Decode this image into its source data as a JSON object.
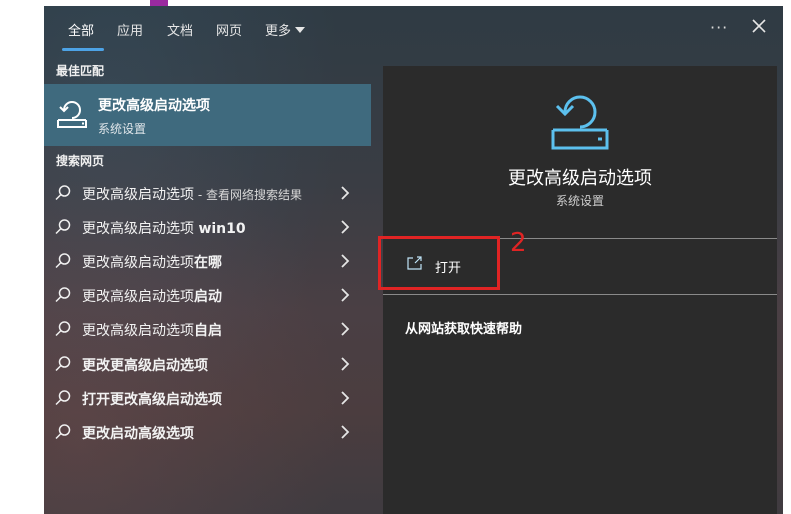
{
  "tabs": [
    {
      "label": "全部"
    },
    {
      "label": "应用"
    },
    {
      "label": "文档"
    },
    {
      "label": "网页"
    },
    {
      "label": "更多"
    }
  ],
  "header": {
    "more_dots": "···"
  },
  "best_match": {
    "heading": "最佳匹配",
    "title": "更改高级启动选项",
    "subtitle": "系统设置",
    "icon": "restore-icon"
  },
  "web": {
    "heading": "搜索网页",
    "results": [
      {
        "plain": "更改高级启动选项",
        "bold": "",
        "suffix": " - 查看网络搜索结果"
      },
      {
        "plain": "更改高级启动选项 ",
        "bold": "win10",
        "suffix": ""
      },
      {
        "plain": "更改高级启动选项",
        "bold": "在哪",
        "suffix": ""
      },
      {
        "plain": "更改高级启动选项",
        "bold": "启动",
        "suffix": ""
      },
      {
        "plain": "更改高级启动选项",
        "bold": "自启",
        "suffix": ""
      },
      {
        "plain": "",
        "bold": "更改更高级启动选项",
        "suffix": ""
      },
      {
        "plain": "",
        "bold": "打开更改高级启动选项",
        "suffix": ""
      },
      {
        "plain": "",
        "bold": "更改启动高级选项",
        "suffix": ""
      }
    ]
  },
  "preview": {
    "title": "更改高级启动选项",
    "subtitle": "系统设置",
    "open_label": "打开",
    "help_label": "从网站获取快速帮助"
  },
  "annotation": {
    "number": "2",
    "color": "#e02424"
  },
  "colors": {
    "accent": "#4da3e6",
    "highlight": "#3f6a7e"
  }
}
